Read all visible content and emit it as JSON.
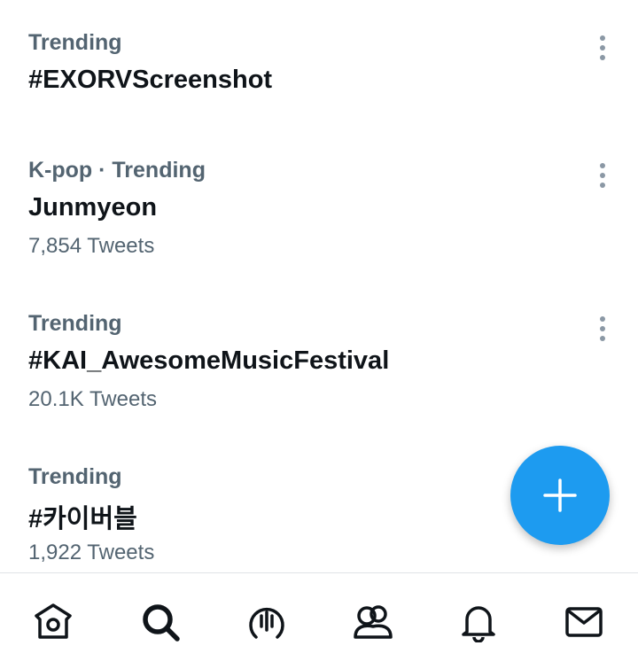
{
  "trends": [
    {
      "context": "Trending",
      "name": "#EXORVScreenshot",
      "count": ""
    },
    {
      "context": "K-pop · Trending",
      "name": "Junmyeon",
      "count": "7,854 Tweets"
    },
    {
      "context": "Trending",
      "name": "#KAI_AwesomeMusicFestival",
      "count": "20.1K Tweets"
    },
    {
      "context": "Trending",
      "name": "#카이버블",
      "count": "1,922 Tweets"
    }
  ],
  "fab": {
    "icon": "plus-icon",
    "color": "#1d9bf0"
  },
  "nav": {
    "items": [
      {
        "icon": "home-icon"
      },
      {
        "icon": "search-icon"
      },
      {
        "icon": "spaces-icon"
      },
      {
        "icon": "communities-icon"
      },
      {
        "icon": "notifications-icon"
      },
      {
        "icon": "messages-icon"
      }
    ]
  },
  "colors": {
    "accent": "#1d9bf0",
    "text_primary": "#0f1419",
    "text_secondary": "#536471"
  }
}
